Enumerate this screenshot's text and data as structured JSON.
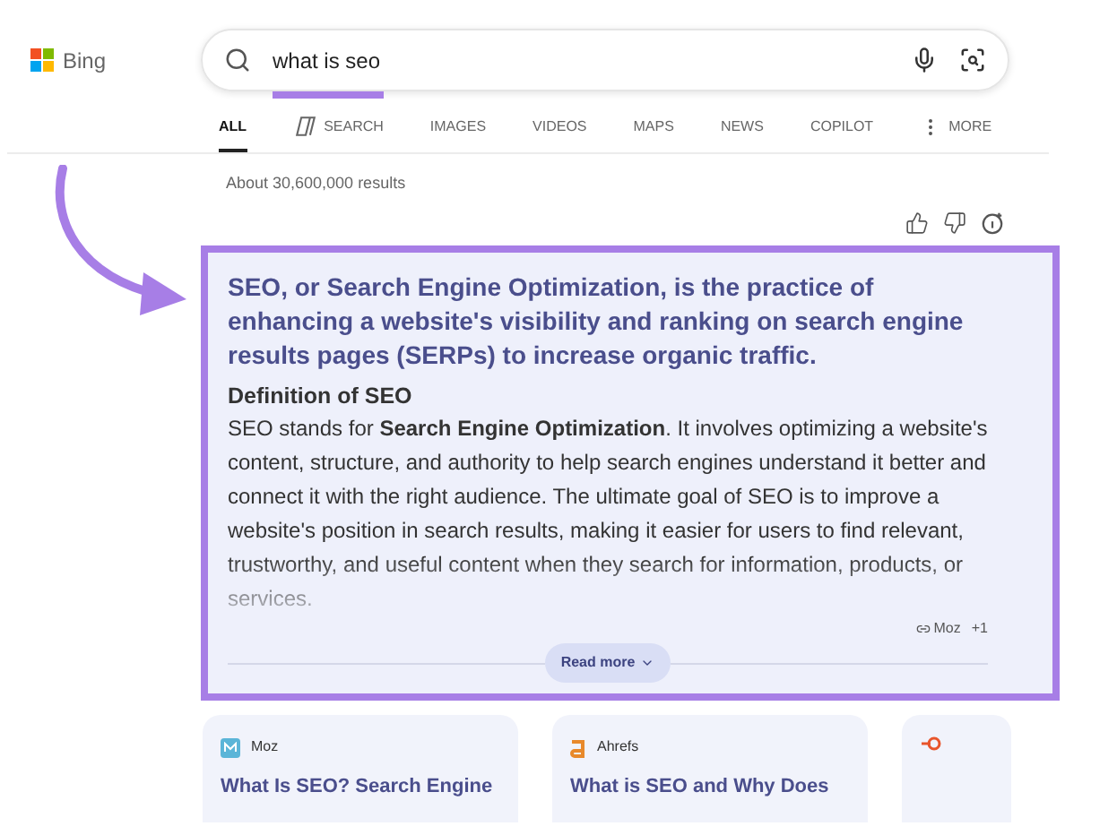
{
  "brand": {
    "name": "Bing"
  },
  "search": {
    "value": "what is seo"
  },
  "tabs": [
    {
      "label": "ALL",
      "selected": true,
      "kind": "plain"
    },
    {
      "label": "SEARCH",
      "selected": false,
      "kind": "copilot"
    },
    {
      "label": "IMAGES",
      "selected": false,
      "kind": "plain"
    },
    {
      "label": "VIDEOS",
      "selected": false,
      "kind": "plain"
    },
    {
      "label": "MAPS",
      "selected": false,
      "kind": "plain"
    },
    {
      "label": "NEWS",
      "selected": false,
      "kind": "plain"
    },
    {
      "label": "COPILOT",
      "selected": false,
      "kind": "plain"
    },
    {
      "label": "MORE",
      "selected": false,
      "kind": "more"
    }
  ],
  "result_count": "About 30,600,000 results",
  "answer": {
    "headline": "SEO, or Search Engine Optimization, is the practice of enhancing a website's visibility and ranking on search engine results pages (SERPs) to increase organic traffic.",
    "subheading": "Definition of SEO",
    "body": "SEO stands for **Search Engine Optimization**. It involves optimizing a website's content, structure, and authority to help search engines understand it better and connect it with the right audience. The ultimate goal of SEO is to improve a website's position in search results, making it easier for users to find relevant, trustworthy, and useful content when they search for information, products, or services.",
    "citation": {
      "source": "Moz",
      "more": "+1"
    },
    "read_more": "Read more"
  },
  "cards": [
    {
      "source": "Moz",
      "kind": "moz",
      "title": "What Is SEO? Search Engine"
    },
    {
      "source": "Ahrefs",
      "kind": "ahrefs",
      "title": "What is SEO and Why Does"
    },
    {
      "kind": "semrush"
    }
  ]
}
